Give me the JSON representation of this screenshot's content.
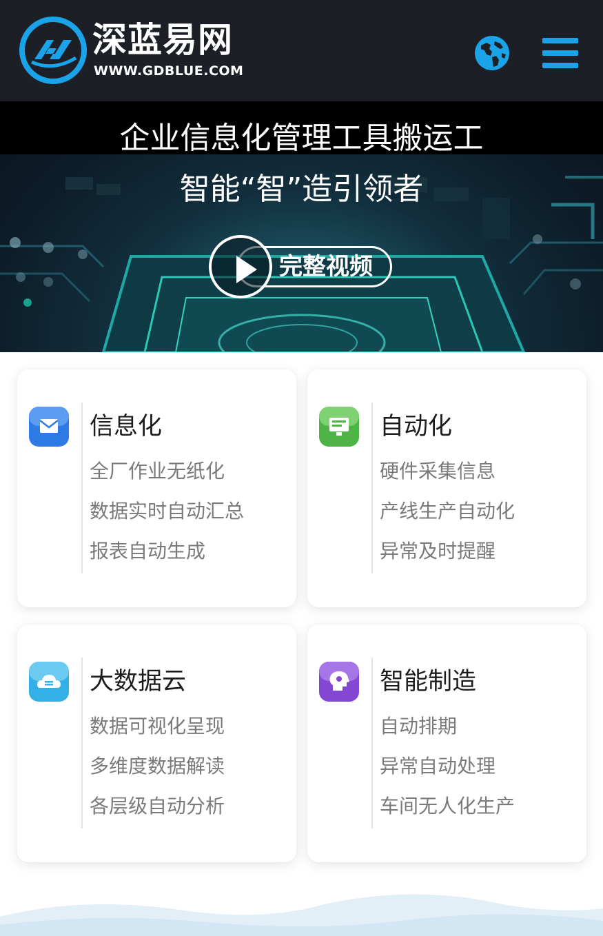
{
  "header": {
    "logo_cn": "深蓝易网",
    "logo_en": "WWW.GDBLUE.COM",
    "globe_icon": "globe-icon",
    "menu_icon": "hamburger-menu-icon"
  },
  "banner": {
    "title": "企业信息化管理工具搬运工",
    "subtitle": "智能“智”造引领者",
    "video_button_label": "完整视频",
    "play_icon": "play-icon"
  },
  "cards": [
    {
      "title": "信息化",
      "icon": "mail-icon",
      "icon_color": "#2f7be6",
      "items": [
        "全厂作业无纸化",
        "数据实时自动汇总",
        "报表自动生成"
      ]
    },
    {
      "title": "自动化",
      "icon": "monitor-icon",
      "icon_color": "#52b948",
      "items": [
        "硬件采集信息",
        "产线生产自动化",
        "异常及时提醒"
      ]
    },
    {
      "title": "大数据云",
      "icon": "cloud-database-icon",
      "icon_color": "#38b6ea",
      "items": [
        "数据可视化呈现",
        "多维度数据解读",
        "各层级自动分析"
      ]
    },
    {
      "title": "智能制造",
      "icon": "smart-brain-icon",
      "icon_color": "#8a4fd8",
      "items": [
        "自动排期",
        "异常自动处理",
        "车间无人化生产"
      ]
    }
  ],
  "colors": {
    "header_bg": "#1c2026",
    "accent": "#1aa3e8",
    "card_title": "#1c1c1c",
    "card_text": "#7a7a7a"
  }
}
